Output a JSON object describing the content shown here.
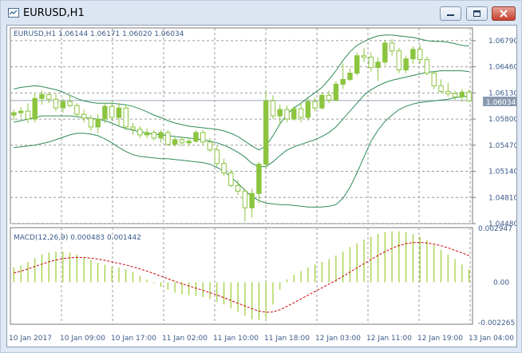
{
  "window": {
    "title": "EURUSD,H1",
    "buttons": {
      "minimize": "minimize-icon",
      "maximize": "maximize-icon",
      "close": "close-icon"
    }
  },
  "price_panel": {
    "header": "EURUSD,H1  1.06144 1.06171 1.06020 1.06034",
    "current_price": "1.06034",
    "y_ticks": [
      "1.06790",
      "1.06460",
      "1.06130",
      "1.05800",
      "1.05470",
      "1.05140",
      "1.04810",
      "1.04480"
    ]
  },
  "macd_panel": {
    "header": "MACD(12,26,9) 0.000483 0.001442",
    "y_ticks": [
      "0.002947",
      "0.00",
      "-0.002265"
    ]
  },
  "time_axis": [
    "10 Jan 2017",
    "10 Jan 09:00",
    "10 Jan 17:00",
    "11 Jan 02:00",
    "11 Jan 10:00",
    "11 Jan 18:00",
    "12 Jan 03:00",
    "12 Jan 11:00",
    "12 Jan 19:00",
    "13 Jan 04:00"
  ],
  "colors": {
    "bull_candle": "#8bc53f",
    "bear_candle": "#ffffff",
    "candle_outline": "#8bc53f",
    "bollinger": "#2e8b57",
    "macd_hist": "#9acd32",
    "macd_signal": "#cc0000",
    "grid": "#9b9b9b"
  },
  "chart_data": [
    {
      "type": "candlestick",
      "symbol": "EURUSD",
      "timeframe": "H1",
      "ylim": [
        1.0448,
        1.0695
      ],
      "yticks": [
        1.0679,
        1.0646,
        1.0613,
        1.058,
        1.0547,
        1.0514,
        1.0481,
        1.0448
      ],
      "last_price": 1.06034,
      "ohlc": [
        [
          1.0585,
          1.0592,
          1.0578,
          1.0588
        ],
        [
          1.0588,
          1.0595,
          1.0582,
          1.059
        ],
        [
          1.059,
          1.06,
          1.0575,
          1.058
        ],
        [
          1.058,
          1.0612,
          1.0576,
          1.0606
        ],
        [
          1.0606,
          1.0616,
          1.0598,
          1.0611
        ],
        [
          1.0611,
          1.0614,
          1.06,
          1.0605
        ],
        [
          1.0605,
          1.0612,
          1.059,
          1.0594
        ],
        [
          1.0594,
          1.0606,
          1.0588,
          1.0602
        ],
        [
          1.0602,
          1.061,
          1.0595,
          1.0597
        ],
        [
          1.0597,
          1.06,
          1.0583,
          1.0586
        ],
        [
          1.0586,
          1.0592,
          1.0576,
          1.0581
        ],
        [
          1.0581,
          1.0585,
          1.0565,
          1.057
        ],
        [
          1.057,
          1.0586,
          1.0562,
          1.058
        ],
        [
          1.058,
          1.06,
          1.0575,
          1.0596
        ],
        [
          1.0596,
          1.0602,
          1.0578,
          1.0582
        ],
        [
          1.0582,
          1.06,
          1.0571,
          1.0594
        ],
        [
          1.0594,
          1.0598,
          1.0566,
          1.057
        ],
        [
          1.057,
          1.0575,
          1.056,
          1.0567
        ],
        [
          1.0567,
          1.0571,
          1.0556,
          1.056
        ],
        [
          1.056,
          1.0568,
          1.0556,
          1.0563
        ],
        [
          1.0563,
          1.0566,
          1.0553,
          1.0556
        ],
        [
          1.0556,
          1.0566,
          1.055,
          1.0563
        ],
        [
          1.0563,
          1.0566,
          1.0546,
          1.0548
        ],
        [
          1.0548,
          1.0557,
          1.0545,
          1.0554
        ],
        [
          1.0554,
          1.0558,
          1.0546,
          1.055
        ],
        [
          1.055,
          1.0556,
          1.0546,
          1.0552
        ],
        [
          1.0552,
          1.0566,
          1.055,
          1.0563
        ],
        [
          1.0563,
          1.0566,
          1.0548,
          1.0551
        ],
        [
          1.0551,
          1.0556,
          1.0538,
          1.0541
        ],
        [
          1.0541,
          1.0546,
          1.052,
          1.0524
        ],
        [
          1.0524,
          1.053,
          1.0508,
          1.0512
        ],
        [
          1.0512,
          1.0516,
          1.0494,
          1.0496
        ],
        [
          1.0496,
          1.0503,
          1.0484,
          1.0489
        ],
        [
          1.0489,
          1.0492,
          1.0451,
          1.0468
        ],
        [
          1.0468,
          1.0492,
          1.0456,
          1.0486
        ],
        [
          1.0486,
          1.0526,
          1.0474,
          1.0523
        ],
        [
          1.0523,
          1.0615,
          1.0518,
          1.0603
        ],
        [
          1.0603,
          1.061,
          1.058,
          1.0584
        ],
        [
          1.0584,
          1.0598,
          1.0572,
          1.0592
        ],
        [
          1.0592,
          1.0597,
          1.0576,
          1.058
        ],
        [
          1.058,
          1.0596,
          1.0578,
          1.0593
        ],
        [
          1.0593,
          1.06,
          1.0576,
          1.0582
        ],
        [
          1.0582,
          1.0606,
          1.0578,
          1.0602
        ],
        [
          1.0602,
          1.0607,
          1.059,
          1.0594
        ],
        [
          1.0594,
          1.0614,
          1.0592,
          1.061
        ],
        [
          1.061,
          1.0616,
          1.06,
          1.0604
        ],
        [
          1.0604,
          1.0628,
          1.0602,
          1.0624
        ],
        [
          1.0624,
          1.065,
          1.0618,
          1.063
        ],
        [
          1.063,
          1.0644,
          1.0628,
          1.0638
        ],
        [
          1.0638,
          1.0664,
          1.0635,
          1.066
        ],
        [
          1.066,
          1.067,
          1.0652,
          1.0658
        ],
        [
          1.0658,
          1.0664,
          1.064,
          1.0645
        ],
        [
          1.0645,
          1.0658,
          1.0628,
          1.0652
        ],
        [
          1.0652,
          1.068,
          1.0648,
          1.0676
        ],
        [
          1.0676,
          1.0681,
          1.066,
          1.0666
        ],
        [
          1.0666,
          1.067,
          1.0638,
          1.0642
        ],
        [
          1.0642,
          1.066,
          1.0638,
          1.0656
        ],
        [
          1.0656,
          1.0672,
          1.065,
          1.0668
        ],
        [
          1.0668,
          1.0674,
          1.065,
          1.0655
        ],
        [
          1.0655,
          1.0659,
          1.0635,
          1.0638
        ],
        [
          1.0638,
          1.064,
          1.0618,
          1.0622
        ],
        [
          1.0622,
          1.063,
          1.0613,
          1.0615
        ],
        [
          1.0615,
          1.0626,
          1.0608,
          1.0612
        ],
        [
          1.0612,
          1.0616,
          1.0604,
          1.0608
        ],
        [
          1.0608,
          1.0618,
          1.0602,
          1.0614
        ],
        [
          1.0614,
          1.0617,
          1.0602,
          1.0603
        ]
      ],
      "bollinger_upper": [
        1.0618,
        1.062,
        1.0621,
        1.0622,
        1.0621,
        1.0619,
        1.0617,
        1.0614,
        1.061,
        1.0606,
        1.0603,
        1.0601,
        1.06,
        1.06,
        1.06,
        1.0599,
        1.0598,
        1.0596,
        1.0593,
        1.0589,
        1.0585,
        1.0582,
        1.0578,
        1.0575,
        1.0573,
        1.0571,
        1.057,
        1.0569,
        1.0568,
        1.0567,
        1.0565,
        1.0562,
        1.0558,
        1.0552,
        1.0546,
        1.0541,
        1.0546,
        1.0559,
        1.0574,
        1.0586,
        1.0594,
        1.06,
        1.0607,
        1.0613,
        1.062,
        1.063,
        1.0641,
        1.0654,
        1.0665,
        1.0673,
        1.0678,
        1.0682,
        1.0685,
        1.0686,
        1.0686,
        1.0685,
        1.0684,
        1.0683,
        1.0681,
        1.0679,
        1.0678,
        1.0678,
        1.0677,
        1.0675,
        1.0673,
        1.0672
      ],
      "bollinger_middle": [
        1.0576,
        1.0578,
        1.058,
        1.0582,
        1.0584,
        1.0584,
        1.0584,
        1.0584,
        1.0584,
        1.0583,
        1.0582,
        1.0581,
        1.058,
        1.0578,
        1.0575,
        1.0571,
        1.0568,
        1.0566,
        1.0564,
        1.0562,
        1.0561,
        1.056,
        1.0559,
        1.0558,
        1.0557,
        1.0556,
        1.0555,
        1.0554,
        1.0552,
        1.055,
        1.0547,
        1.0543,
        1.0538,
        1.0532,
        1.0524,
        1.052,
        1.052,
        1.0526,
        1.0534,
        1.0541,
        1.0545,
        1.0548,
        1.0551,
        1.0554,
        1.0558,
        1.0563,
        1.057,
        1.058,
        1.059,
        1.06,
        1.061,
        1.0617,
        1.0622,
        1.0626,
        1.0629,
        1.0631,
        1.0633,
        1.0635,
        1.0637,
        1.0639,
        1.064,
        1.0641,
        1.0641,
        1.0641,
        1.0641,
        1.064
      ],
      "bollinger_lower": [
        1.0544,
        1.0545,
        1.0546,
        1.0547,
        1.0549,
        1.0551,
        1.0554,
        1.0557,
        1.056,
        1.0562,
        1.0562,
        1.0561,
        1.0559,
        1.0555,
        1.055,
        1.0544,
        1.0539,
        1.0535,
        1.0533,
        1.0532,
        1.0531,
        1.053,
        1.053,
        1.0529,
        1.0528,
        1.0527,
        1.0526,
        1.0525,
        1.0523,
        1.0519,
        1.0514,
        1.0507,
        1.0499,
        1.049,
        1.0482,
        1.0477,
        1.0474,
        1.0473,
        1.0472,
        1.0472,
        1.0471,
        1.047,
        1.0469,
        1.0469,
        1.0469,
        1.047,
        1.0472,
        1.048,
        1.0494,
        1.0512,
        1.0532,
        1.0552,
        1.0566,
        1.0577,
        1.0585,
        1.0592,
        1.0596,
        1.0599,
        1.0601,
        1.0602,
        1.0603,
        1.0604,
        1.0605,
        1.0607,
        1.0608,
        1.0609
      ]
    },
    {
      "type": "bar",
      "name": "MACD(12,26,9)",
      "ylim": [
        -0.002265,
        0.002947
      ],
      "yticks": [
        0.002947,
        0.0,
        -0.002265
      ],
      "macd_histogram": [
        0.0008,
        0.0009,
        0.0011,
        0.0013,
        0.0015,
        0.0016,
        0.00165,
        0.00165,
        0.0016,
        0.0015,
        0.00135,
        0.0012,
        0.00105,
        0.00095,
        0.00085,
        0.0008,
        0.0007,
        0.00055,
        0.00035,
        0.00015,
        -5e-05,
        -0.00025,
        -0.0004,
        -0.00055,
        -0.00065,
        -0.0007,
        -0.00075,
        -0.0008,
        -0.0009,
        -0.00105,
        -0.0012,
        -0.0014,
        -0.0016,
        -0.0018,
        -0.002,
        -0.00205,
        -0.00195,
        -0.0012,
        -0.0004,
        0.00015,
        0.0004,
        0.0006,
        0.0008,
        0.00095,
        0.0011,
        0.00125,
        0.00145,
        0.00165,
        0.0019,
        0.0021,
        0.0023,
        0.00245,
        0.0026,
        0.0027,
        0.00275,
        0.00275,
        0.0027,
        0.0026,
        0.00245,
        0.00225,
        0.002,
        0.00175,
        0.0015,
        0.00125,
        0.00095,
        0.0007
      ],
      "signal": [
        0.0005,
        0.0006,
        0.00072,
        0.00085,
        0.00098,
        0.0011,
        0.0012,
        0.00127,
        0.00132,
        0.00134,
        0.00133,
        0.0013,
        0.00125,
        0.00118,
        0.0011,
        0.00102,
        0.00093,
        0.00083,
        0.00072,
        0.0006,
        0.00047,
        0.00033,
        0.00019,
        5e-05,
        -8e-05,
        -0.0002,
        -0.00032,
        -0.00044,
        -0.00056,
        -0.00069,
        -0.00083,
        -0.00098,
        -0.00113,
        -0.00128,
        -0.00143,
        -0.00155,
        -0.00162,
        -0.0016,
        -0.00148,
        -0.0013,
        -0.0011,
        -0.0009,
        -0.0007,
        -0.0005,
        -0.0003,
        -0.0001,
        0.0001,
        0.00032,
        0.00055,
        0.00078,
        0.001,
        0.00122,
        0.00145,
        0.00165,
        0.00183,
        0.00198,
        0.00208,
        0.00214,
        0.00215,
        0.00212,
        0.00206,
        0.00197,
        0.00186,
        0.00172,
        0.00158,
        0.00144
      ]
    }
  ]
}
